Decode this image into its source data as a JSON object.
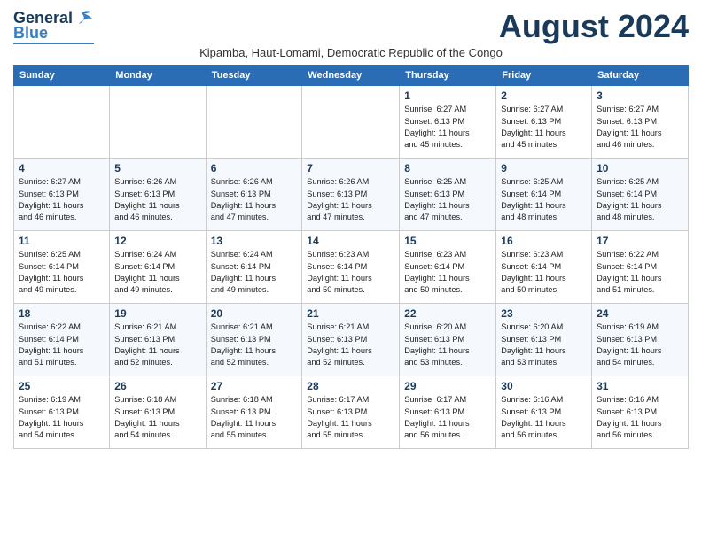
{
  "header": {
    "logo_line1": "General",
    "logo_line2": "Blue",
    "month_title": "August 2024",
    "subtitle": "Kipamba, Haut-Lomami, Democratic Republic of the Congo"
  },
  "days_of_week": [
    "Sunday",
    "Monday",
    "Tuesday",
    "Wednesday",
    "Thursday",
    "Friday",
    "Saturday"
  ],
  "weeks": [
    [
      {
        "num": "",
        "info": ""
      },
      {
        "num": "",
        "info": ""
      },
      {
        "num": "",
        "info": ""
      },
      {
        "num": "",
        "info": ""
      },
      {
        "num": "1",
        "info": "Sunrise: 6:27 AM\nSunset: 6:13 PM\nDaylight: 11 hours\nand 45 minutes."
      },
      {
        "num": "2",
        "info": "Sunrise: 6:27 AM\nSunset: 6:13 PM\nDaylight: 11 hours\nand 45 minutes."
      },
      {
        "num": "3",
        "info": "Sunrise: 6:27 AM\nSunset: 6:13 PM\nDaylight: 11 hours\nand 46 minutes."
      }
    ],
    [
      {
        "num": "4",
        "info": "Sunrise: 6:27 AM\nSunset: 6:13 PM\nDaylight: 11 hours\nand 46 minutes."
      },
      {
        "num": "5",
        "info": "Sunrise: 6:26 AM\nSunset: 6:13 PM\nDaylight: 11 hours\nand 46 minutes."
      },
      {
        "num": "6",
        "info": "Sunrise: 6:26 AM\nSunset: 6:13 PM\nDaylight: 11 hours\nand 47 minutes."
      },
      {
        "num": "7",
        "info": "Sunrise: 6:26 AM\nSunset: 6:13 PM\nDaylight: 11 hours\nand 47 minutes."
      },
      {
        "num": "8",
        "info": "Sunrise: 6:25 AM\nSunset: 6:13 PM\nDaylight: 11 hours\nand 47 minutes."
      },
      {
        "num": "9",
        "info": "Sunrise: 6:25 AM\nSunset: 6:14 PM\nDaylight: 11 hours\nand 48 minutes."
      },
      {
        "num": "10",
        "info": "Sunrise: 6:25 AM\nSunset: 6:14 PM\nDaylight: 11 hours\nand 48 minutes."
      }
    ],
    [
      {
        "num": "11",
        "info": "Sunrise: 6:25 AM\nSunset: 6:14 PM\nDaylight: 11 hours\nand 49 minutes."
      },
      {
        "num": "12",
        "info": "Sunrise: 6:24 AM\nSunset: 6:14 PM\nDaylight: 11 hours\nand 49 minutes."
      },
      {
        "num": "13",
        "info": "Sunrise: 6:24 AM\nSunset: 6:14 PM\nDaylight: 11 hours\nand 49 minutes."
      },
      {
        "num": "14",
        "info": "Sunrise: 6:23 AM\nSunset: 6:14 PM\nDaylight: 11 hours\nand 50 minutes."
      },
      {
        "num": "15",
        "info": "Sunrise: 6:23 AM\nSunset: 6:14 PM\nDaylight: 11 hours\nand 50 minutes."
      },
      {
        "num": "16",
        "info": "Sunrise: 6:23 AM\nSunset: 6:14 PM\nDaylight: 11 hours\nand 50 minutes."
      },
      {
        "num": "17",
        "info": "Sunrise: 6:22 AM\nSunset: 6:14 PM\nDaylight: 11 hours\nand 51 minutes."
      }
    ],
    [
      {
        "num": "18",
        "info": "Sunrise: 6:22 AM\nSunset: 6:14 PM\nDaylight: 11 hours\nand 51 minutes."
      },
      {
        "num": "19",
        "info": "Sunrise: 6:21 AM\nSunset: 6:13 PM\nDaylight: 11 hours\nand 52 minutes."
      },
      {
        "num": "20",
        "info": "Sunrise: 6:21 AM\nSunset: 6:13 PM\nDaylight: 11 hours\nand 52 minutes."
      },
      {
        "num": "21",
        "info": "Sunrise: 6:21 AM\nSunset: 6:13 PM\nDaylight: 11 hours\nand 52 minutes."
      },
      {
        "num": "22",
        "info": "Sunrise: 6:20 AM\nSunset: 6:13 PM\nDaylight: 11 hours\nand 53 minutes."
      },
      {
        "num": "23",
        "info": "Sunrise: 6:20 AM\nSunset: 6:13 PM\nDaylight: 11 hours\nand 53 minutes."
      },
      {
        "num": "24",
        "info": "Sunrise: 6:19 AM\nSunset: 6:13 PM\nDaylight: 11 hours\nand 54 minutes."
      }
    ],
    [
      {
        "num": "25",
        "info": "Sunrise: 6:19 AM\nSunset: 6:13 PM\nDaylight: 11 hours\nand 54 minutes."
      },
      {
        "num": "26",
        "info": "Sunrise: 6:18 AM\nSunset: 6:13 PM\nDaylight: 11 hours\nand 54 minutes."
      },
      {
        "num": "27",
        "info": "Sunrise: 6:18 AM\nSunset: 6:13 PM\nDaylight: 11 hours\nand 55 minutes."
      },
      {
        "num": "28",
        "info": "Sunrise: 6:17 AM\nSunset: 6:13 PM\nDaylight: 11 hours\nand 55 minutes."
      },
      {
        "num": "29",
        "info": "Sunrise: 6:17 AM\nSunset: 6:13 PM\nDaylight: 11 hours\nand 56 minutes."
      },
      {
        "num": "30",
        "info": "Sunrise: 6:16 AM\nSunset: 6:13 PM\nDaylight: 11 hours\nand 56 minutes."
      },
      {
        "num": "31",
        "info": "Sunrise: 6:16 AM\nSunset: 6:13 PM\nDaylight: 11 hours\nand 56 minutes."
      }
    ]
  ]
}
